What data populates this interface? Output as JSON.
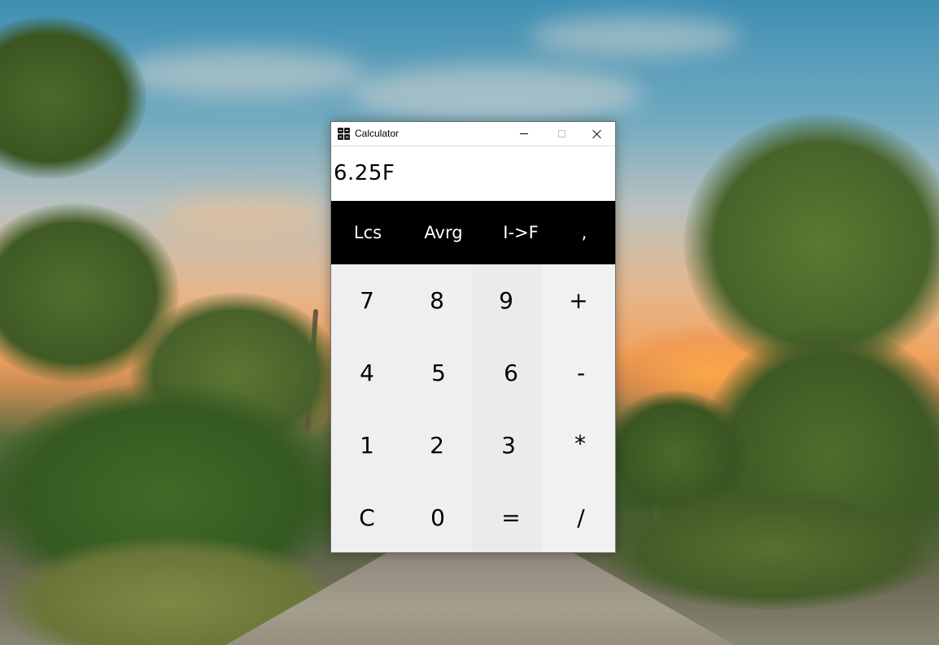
{
  "window": {
    "title": "Calculator",
    "minimize_icon": "minimize-icon",
    "maximize_icon": "maximize-icon",
    "close_icon": "close-icon"
  },
  "display": {
    "value": "6.25F"
  },
  "function_row": [
    "Lcs",
    "Avrg",
    "I->F",
    ","
  ],
  "keypad": {
    "rows": [
      [
        "7",
        "8",
        "9",
        "+"
      ],
      [
        "4",
        "5",
        "6",
        "-"
      ],
      [
        "1",
        "2",
        "3",
        "*"
      ],
      [
        "C",
        "0",
        "=",
        "/"
      ]
    ]
  },
  "colors": {
    "function_row_bg": "#000000",
    "function_row_text": "#ffffff",
    "keypad_bg": "#efefef",
    "display_bg": "#ffffff"
  }
}
